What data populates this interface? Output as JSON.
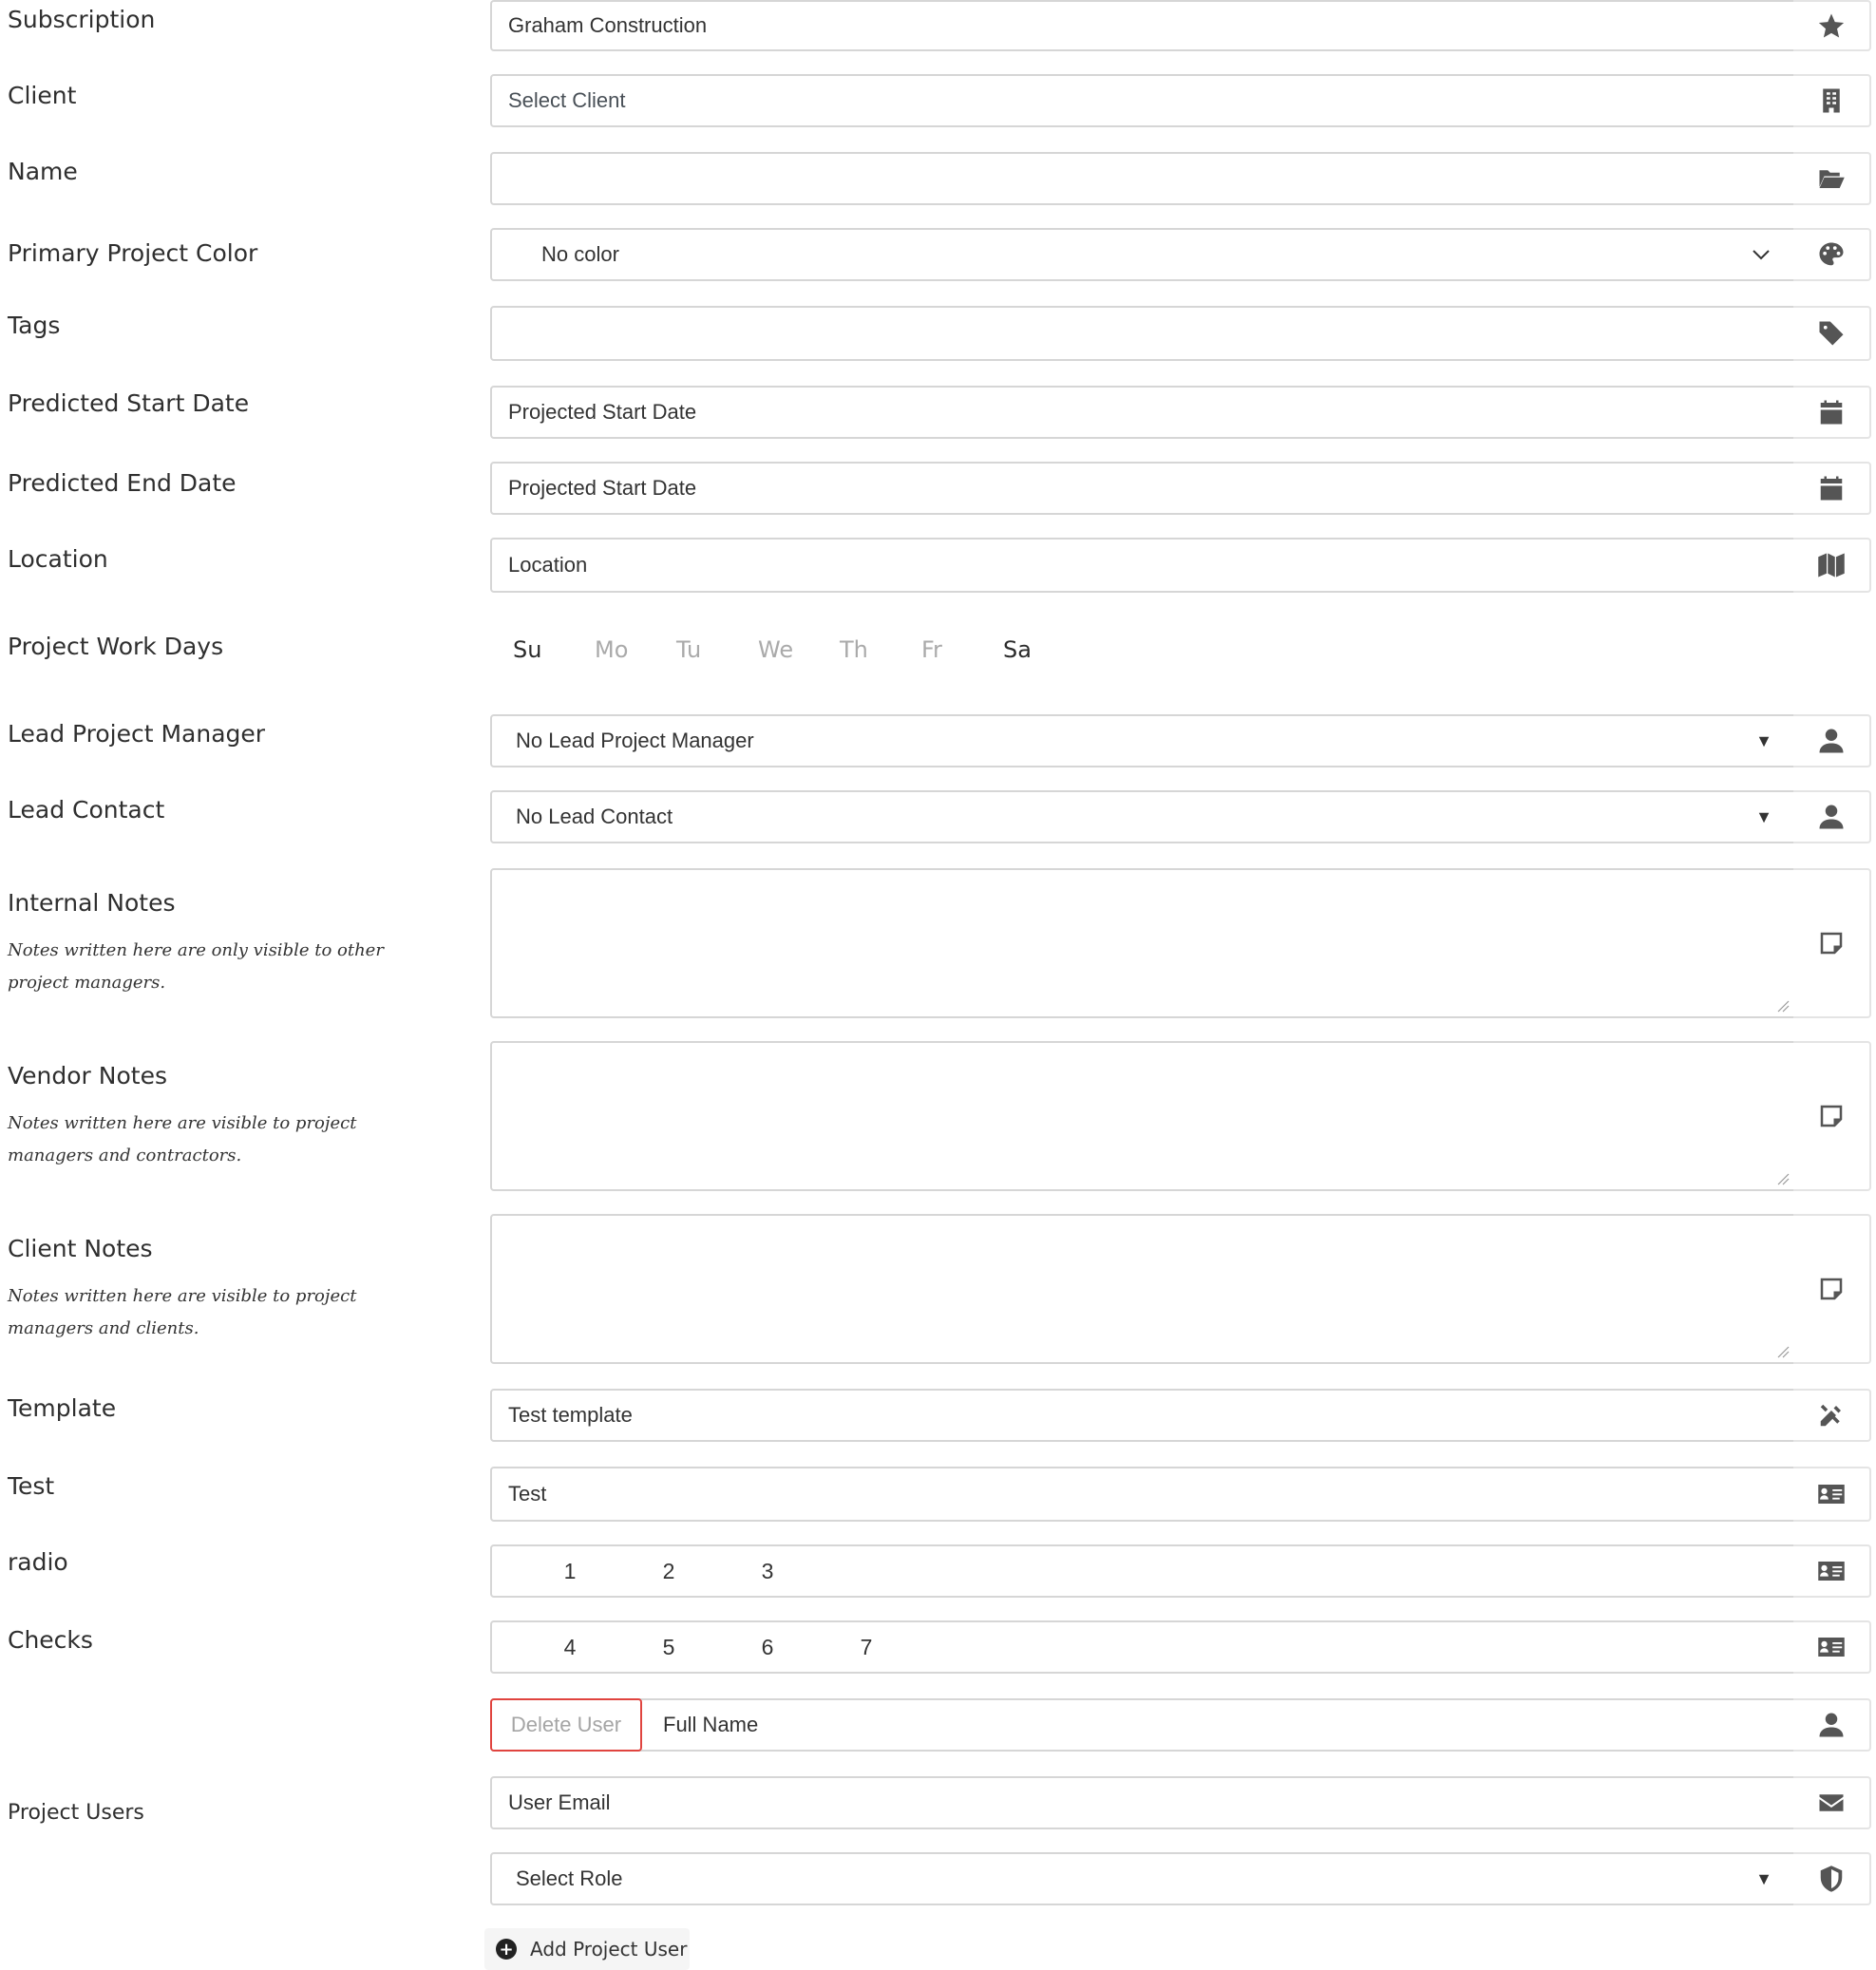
{
  "labels": {
    "subscription": "Subscription",
    "client": "Client",
    "name": "Name",
    "primary_color": "Primary Project Color",
    "tags": "Tags",
    "start_date": "Predicted Start Date",
    "end_date": "Predicted End Date",
    "location": "Location",
    "work_days": "Project Work Days",
    "lead_pm": "Lead Project Manager",
    "lead_contact": "Lead Contact",
    "internal_notes": "Internal Notes",
    "vendor_notes": "Vendor Notes",
    "client_notes": "Client Notes",
    "template": "Template",
    "test": "Test",
    "radio": "radio",
    "checks": "Checks",
    "project_users": "Project Users"
  },
  "hints": {
    "internal_notes": "Notes written here are only visible to other project managers.",
    "vendor_notes": "Notes written here are visible to project managers and contractors.",
    "client_notes": "Notes written here are visible to project managers and clients."
  },
  "fields": {
    "subscription": "Graham Construction",
    "client": "Select Client",
    "name": "",
    "primary_color": "No color",
    "tags": "",
    "start_date_placeholder": "Projected Start Date",
    "end_date_placeholder": "Projected Start Date",
    "location_placeholder": "Location",
    "lead_pm": "No Lead Project Manager",
    "lead_contact": "No Lead Contact",
    "template": "Test template",
    "test": "Test",
    "radio_options": [
      "1",
      "2",
      "3"
    ],
    "check_options": [
      "4",
      "5",
      "6",
      "7"
    ]
  },
  "work_days": [
    {
      "label": "Su",
      "active": true
    },
    {
      "label": "Mo",
      "active": false
    },
    {
      "label": "Tu",
      "active": false
    },
    {
      "label": "We",
      "active": false
    },
    {
      "label": "Th",
      "active": false
    },
    {
      "label": "Fr",
      "active": false
    },
    {
      "label": "Sa",
      "active": true
    }
  ],
  "project_user": {
    "delete_label": "Delete User",
    "full_name_placeholder": "Full Name",
    "email_placeholder": "User Email",
    "role": "Select Role"
  },
  "add_user_label": "Add Project User",
  "icons": {
    "subscription": "star-icon",
    "client": "building-icon",
    "name": "folder-open-icon",
    "color": "palette-icon",
    "tags": "tag-icon",
    "date": "calendar-icon",
    "location": "map-icon",
    "user": "user-icon",
    "note": "sticky-note-icon",
    "template": "tools-icon",
    "id_card": "id-card-icon",
    "email": "envelope-icon",
    "role": "shield-icon"
  },
  "colors": {
    "delete_border": "#e0443f",
    "inactive_day": "#aaaaaa"
  }
}
